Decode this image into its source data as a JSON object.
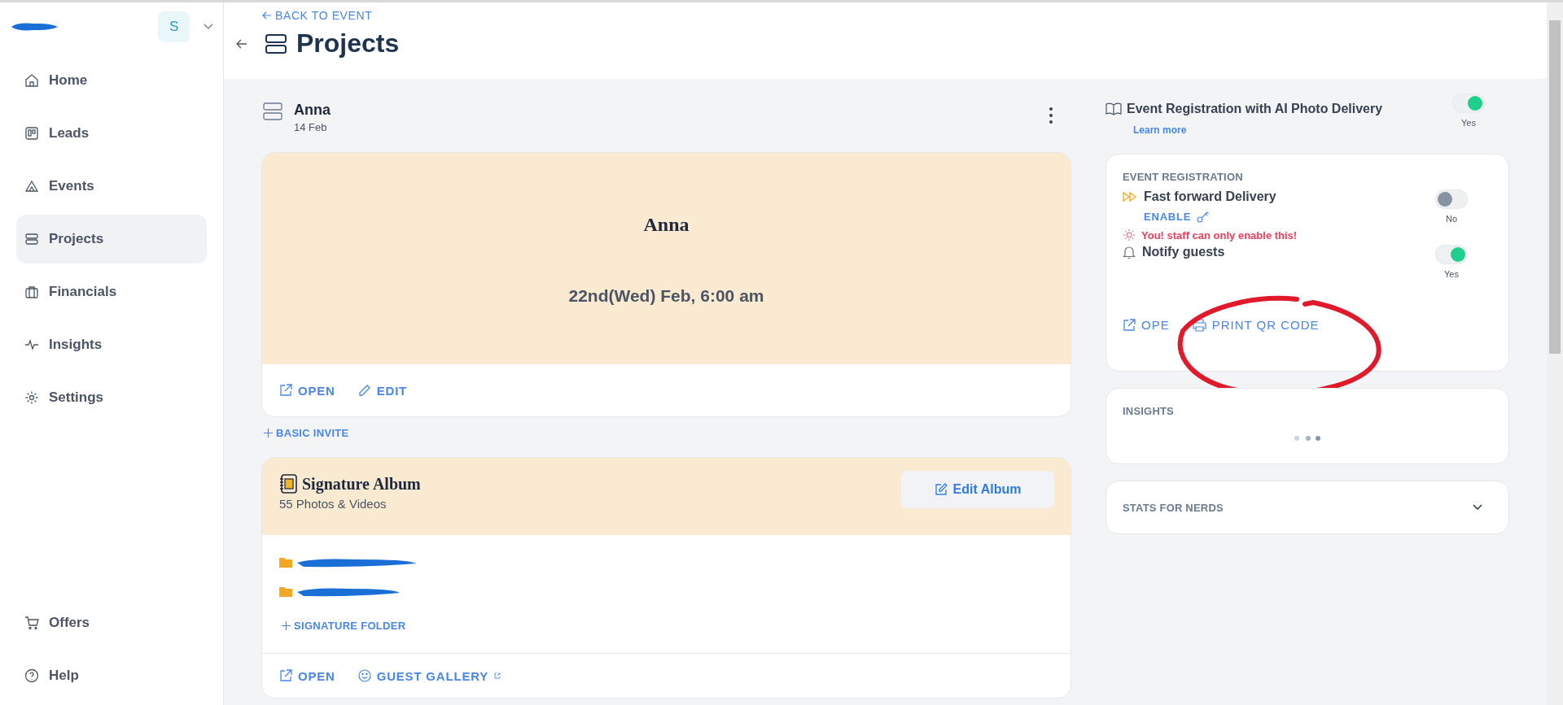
{
  "sidebar": {
    "avatar": "S",
    "items": [
      {
        "label": "Home",
        "selected": false
      },
      {
        "label": "Leads",
        "selected": false
      },
      {
        "label": "Events",
        "selected": false
      },
      {
        "label": "Projects",
        "selected": true
      },
      {
        "label": "Financials",
        "selected": false
      },
      {
        "label": "Insights",
        "selected": false
      },
      {
        "label": "Settings",
        "selected": false
      }
    ],
    "bottom_items": [
      {
        "label": "Offers"
      },
      {
        "label": "Help"
      }
    ]
  },
  "header": {
    "back_link": "BACK TO EVENT",
    "title": "Projects"
  },
  "project": {
    "name": "Anna",
    "date": "14 Feb"
  },
  "invite": {
    "title": "Anna",
    "datetime": "22nd(Wed) Feb, 6:00 am",
    "actions": [
      "OPEN",
      "EDIT"
    ]
  },
  "add_invite": "BASIC INVITE",
  "album": {
    "title": "Signature Album",
    "count": "55 Photos & Videos",
    "edit_button": "Edit Album",
    "folders": [
      {
        "kind": "redacted"
      },
      {
        "kind": "redacted"
      }
    ],
    "add_folder": "SIGNATURE FOLDER",
    "actions": [
      "OPEN",
      "GUEST GALLERY"
    ]
  },
  "registration": {
    "title": "Event Registration with AI Photo Delivery",
    "learn_more": "Learn more",
    "on": true,
    "state_label": "Yes"
  },
  "event_registration": {
    "heading": "EVENT REGISTRATION",
    "options": [
      {
        "label": "Fast forward Delivery",
        "on": false,
        "state_label": "No",
        "action": "ENABLE",
        "warning": "You! staff can only enable this!"
      },
      {
        "label": "Notify guests",
        "on": true,
        "state_label": "Yes"
      }
    ],
    "actions": [
      "OPE",
      "PRINT QR CODE"
    ]
  },
  "insights": {
    "heading": "INSIGHTS"
  },
  "stats": {
    "heading": "STATS FOR NERDS",
    "expanded": false
  }
}
